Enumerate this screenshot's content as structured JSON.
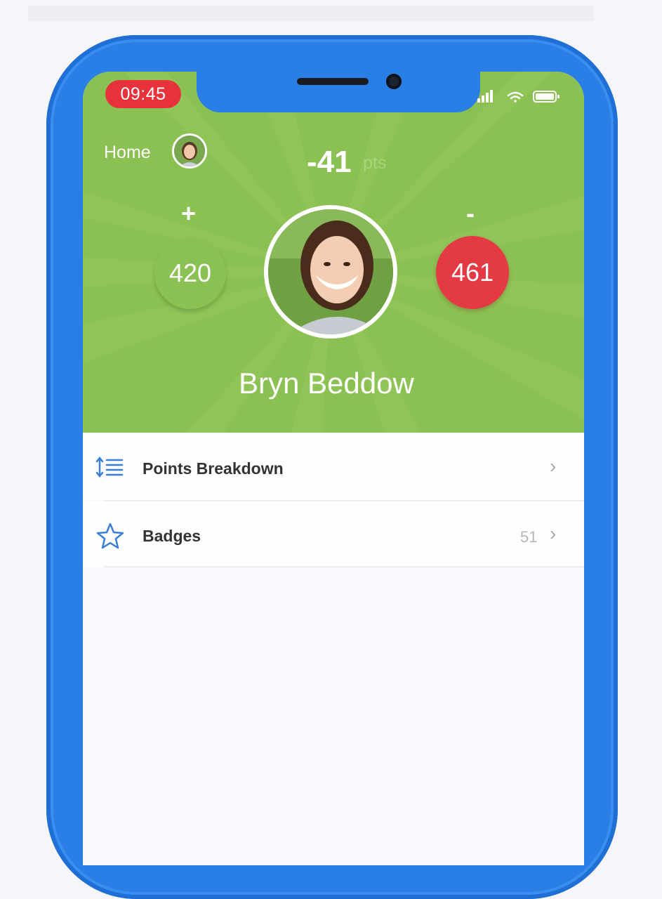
{
  "status_bar": {
    "time": "09:45"
  },
  "header": {
    "home_label": "Home",
    "total_points": "-41",
    "points_unit": "pts",
    "positive_symbol": "+",
    "negative_symbol": "-",
    "positive_points": "420",
    "negative_points": "461",
    "student_name": "Bryn Beddow"
  },
  "menu": {
    "items": [
      {
        "label": "Points Breakdown",
        "icon": "sort-list-icon",
        "count": ""
      },
      {
        "label": "Badges",
        "icon": "star-outline-icon",
        "count": "51"
      }
    ]
  },
  "colors": {
    "phone_frame": "#2a7fe6",
    "header_green": "#8bc053",
    "negative_red": "#e33a44",
    "time_pill_red": "#e8323b",
    "icon_blue": "#3a7fd6"
  }
}
